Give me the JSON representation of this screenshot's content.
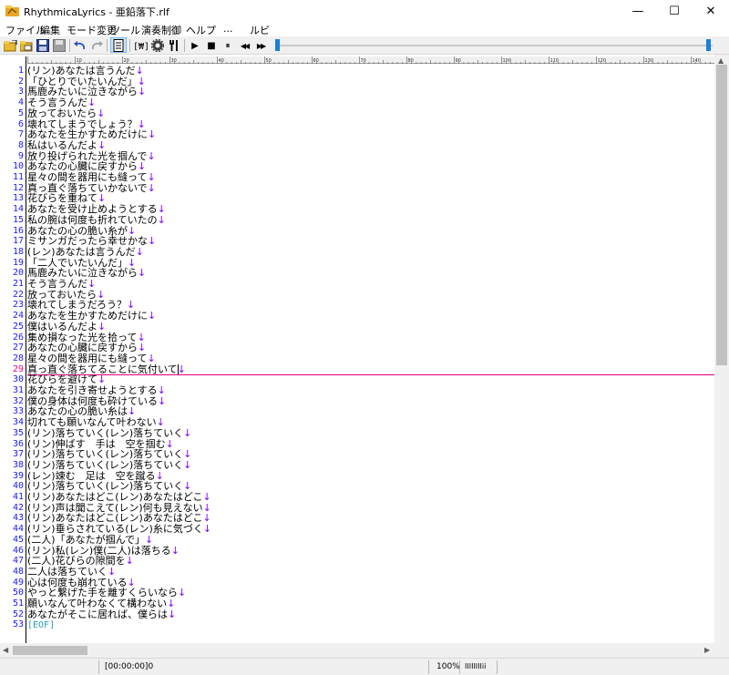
{
  "window": {
    "title": "RhythmicaLyrics - 亜鉛落下.rlf",
    "minimize_glyph": "—",
    "maximize_glyph": "☐",
    "close_glyph": "✕"
  },
  "menu": [
    "ファイル",
    "編集",
    "モード変更",
    "ツール",
    "演奏制御",
    "ヘルプ",
    "...",
    "ルビ"
  ],
  "toolbar": {
    "play_glyph": "▶",
    "stop_glyph": "■",
    "pause_glyph": "⏸",
    "rewind_glyph": "◀◀",
    "forward_glyph": "▶▶"
  },
  "ruler": {
    "labels": [
      "10",
      "20",
      "30",
      "40",
      "50",
      "60",
      "70",
      "80",
      "90",
      "100",
      "110",
      "120",
      "130",
      "140"
    ]
  },
  "editor": {
    "current_line": 29,
    "return_mark": "↓",
    "eof_mark": "[EOF]",
    "lines": [
      "(リン)あなたは言うんだ",
      "「ひとりでいたいんだ」",
      "馬鹿みたいに泣きながら",
      "そう言うんだ",
      "放っておいたら",
      "壊れてしまうでしょう？",
      "あなたを生かすためだけに",
      "私はいるんだよ",
      "放り投げられた光を掴んで",
      "あなたの心臓に戻すから",
      "星々の間を器用にも縫って",
      "真っ直ぐ落ちていかないで",
      "花びらを重ねて",
      "あなたを受け止めようとする",
      "私の腕は何度も折れていたの",
      "あなたの心の脆い糸が",
      "ミサンガだったら幸せかな",
      "(レン)あなたは言うんだ",
      "「二人でいたいんだ」",
      "馬鹿みたいに泣きながら",
      "そう言うんだ",
      "放っておいたら",
      "壊れてしまうだろう？",
      "あなたを生かすためだけに",
      "僕はいるんだよ",
      "集め損なった光を拾って",
      "あなたの心臓に戻すから",
      "星々の間を器用にも縫って",
      "真っ直ぐ落ちてることに気付いて",
      "花びらを避けて",
      "あなたを引き寄せようとする",
      "僕の身体は何度も砕けている",
      "あなたの心の脆い糸は",
      "切れても願いなんて叶わない",
      "(リン)落ちていく(レン)落ちていく",
      "(リン)伸ばす　手は　空を掴む",
      "(リン)落ちていく(レン)落ちていく",
      "(リン)落ちていく(レン)落ちていく",
      "(レン)竦む　足は　空を蹴る",
      "(リン)落ちていく(レン)落ちていく",
      "(リン)あなたはどこ(レン)あなたはどこ",
      "(リン)声は聞こえて(レン)何も見えない",
      "(リン)あなたはどこ(レン)あなたはどこ",
      "(リン)垂らされている(レン)糸に気づく",
      "(二人)「あなたが掴んで」",
      "(リン)私(レン)僕(二人)は落ちる",
      "(二人)花びらの隙間を",
      "二人は落ちていく",
      "心は何度も崩れている",
      "やっと繋げた手を離すくらいなら",
      "願いなんて叶わなくて構わない",
      "あなたがそこに居れば、僕らは"
    ]
  },
  "status": {
    "time": "[00:00:00]0",
    "zoom": "100%",
    "indicator": "IIIIIIIIii"
  }
}
